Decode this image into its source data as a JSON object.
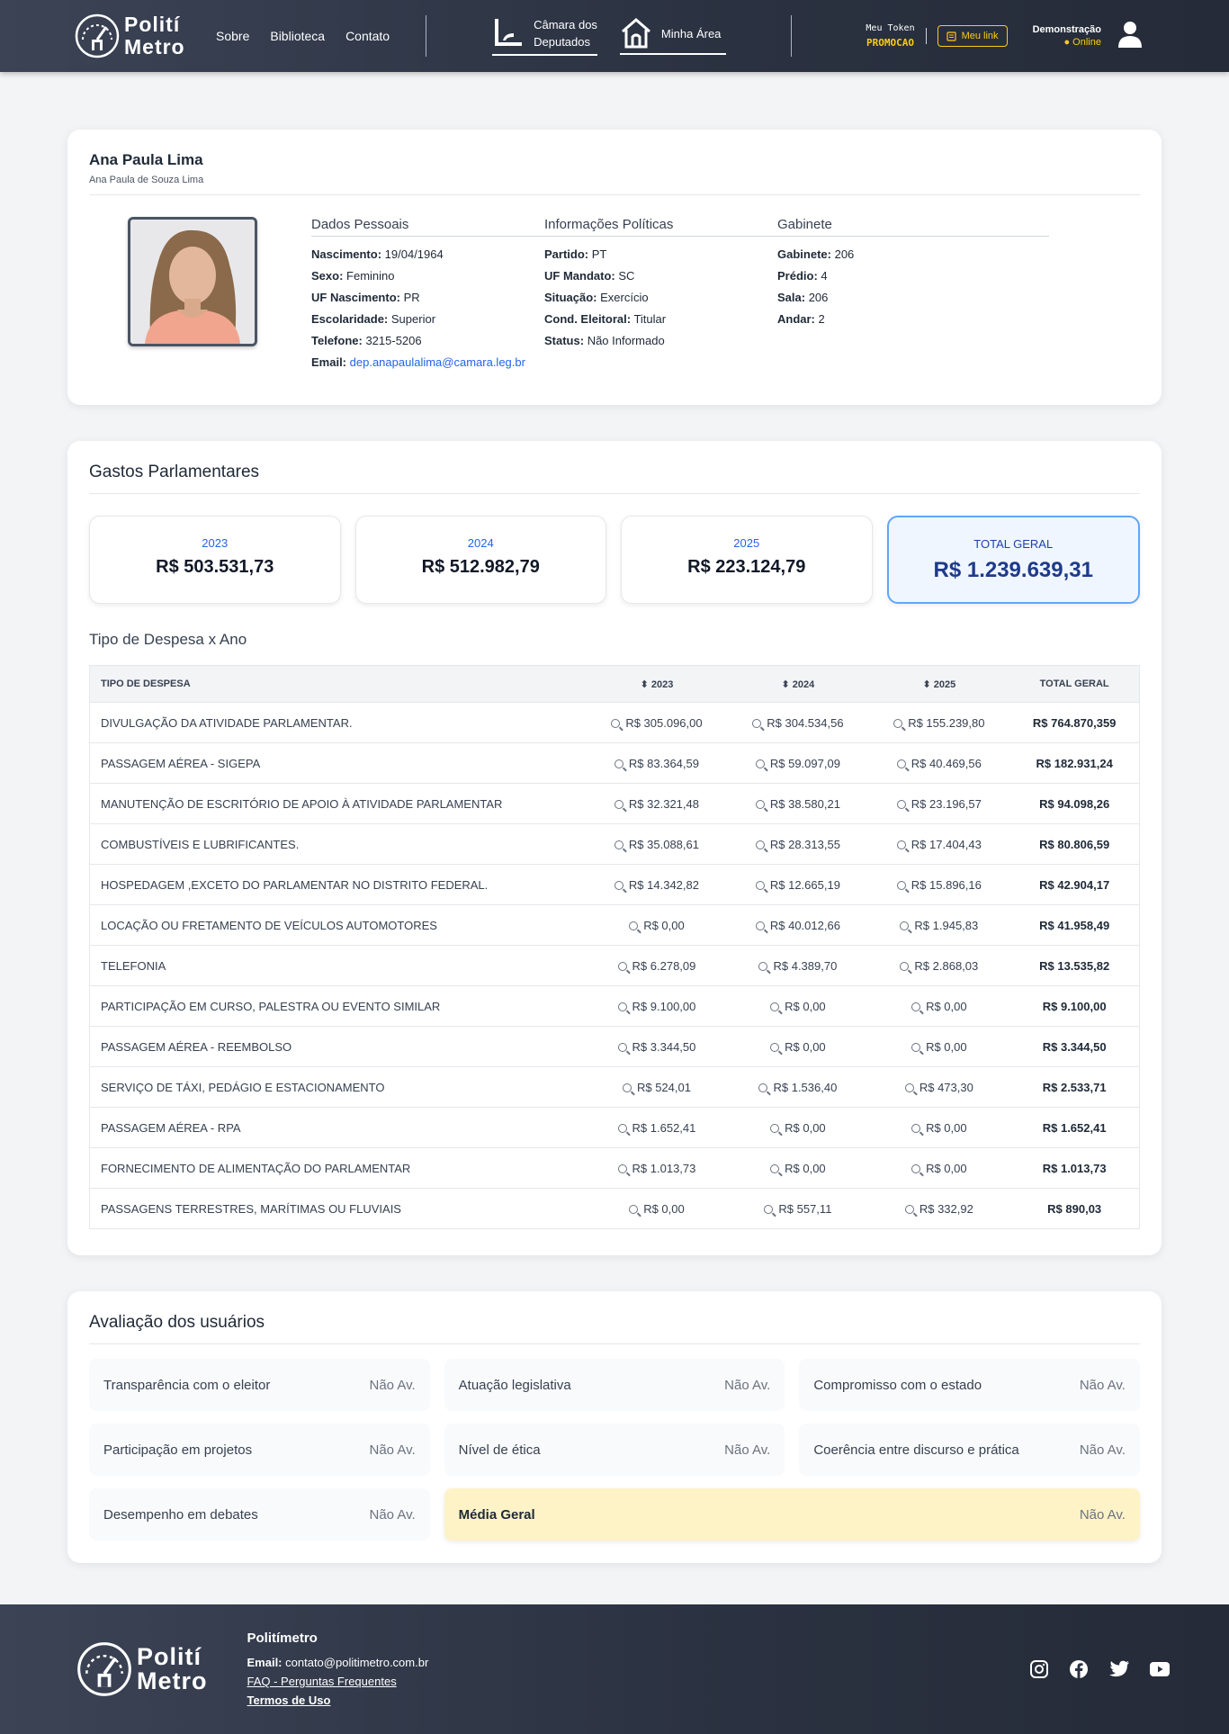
{
  "header": {
    "logo": {
      "line1": "Polití",
      "line2": "Metro"
    },
    "nav": [
      "Sobre",
      "Biblioteca",
      "Contato"
    ],
    "camara": {
      "line1": "Câmara dos",
      "line2": "Deputados"
    },
    "minha_area": "Minha Área",
    "token_label": "Meu Token",
    "token_value": "PROMOCAO",
    "meu_link": "Meu link",
    "user_name": "Demonstração",
    "user_status": "● Online"
  },
  "profile": {
    "name": "Ana Paula Lima",
    "full_name": "Ana Paula de Souza Lima",
    "dados_title": "Dados Pessoais",
    "dados": [
      {
        "label": "Nascimento:",
        "value": "19/04/1964"
      },
      {
        "label": "Sexo:",
        "value": "Feminino"
      },
      {
        "label": "UF Nascimento:",
        "value": "PR"
      },
      {
        "label": "Escolaridade:",
        "value": "Superior"
      },
      {
        "label": "Telefone:",
        "value": "3215-5206"
      },
      {
        "label": "Email:",
        "value": "dep.anapaulalima@camara.leg.br"
      }
    ],
    "politicas_title": "Informações Políticas",
    "politicas": [
      {
        "label": "Partido:",
        "value": "PT"
      },
      {
        "label": "UF Mandato:",
        "value": "SC"
      },
      {
        "label": "Situação:",
        "value": "Exercício"
      },
      {
        "label": "Cond. Eleitoral:",
        "value": "Titular"
      },
      {
        "label": "Status:",
        "value": "Não Informado"
      }
    ],
    "gabinete_title": "Gabinete",
    "gabinete": [
      {
        "label": "Gabinete:",
        "value": "206"
      },
      {
        "label": "Prédio:",
        "value": "4"
      },
      {
        "label": "Sala:",
        "value": "206"
      },
      {
        "label": "Andar:",
        "value": "2"
      }
    ]
  },
  "gastos": {
    "title": "Gastos Parlamentares",
    "years": [
      {
        "label": "2023",
        "value": "R$ 503.531,73"
      },
      {
        "label": "2024",
        "value": "R$ 512.982,79"
      },
      {
        "label": "2025",
        "value": "R$ 223.124,79"
      }
    ],
    "total": {
      "label": "TOTAL GERAL",
      "value": "R$ 1.239.639,31"
    },
    "table_title": "Tipo de Despesa x Ano",
    "columns": [
      "TIPO DE DESPESA",
      "⬍ 2023",
      "⬍ 2024",
      "⬍ 2025",
      "TOTAL GERAL"
    ],
    "rows": [
      [
        "DIVULGAÇÃO DA ATIVIDADE PARLAMENTAR.",
        "R$ 305.096,00",
        "R$ 304.534,56",
        "R$ 155.239,80",
        "R$ 764.870,359"
      ],
      [
        "PASSAGEM AÉREA - SIGEPA",
        "R$ 83.364,59",
        "R$ 59.097,09",
        "R$ 40.469,56",
        "R$ 182.931,24"
      ],
      [
        "MANUTENÇÃO DE ESCRITÓRIO DE APOIO À ATIVIDADE PARLAMENTAR",
        "R$ 32.321,48",
        "R$ 38.580,21",
        "R$ 23.196,57",
        "R$ 94.098,26"
      ],
      [
        "COMBUSTÍVEIS E LUBRIFICANTES.",
        "R$ 35.088,61",
        "R$ 28.313,55",
        "R$ 17.404,43",
        "R$ 80.806,59"
      ],
      [
        "HOSPEDAGEM ,EXCETO DO PARLAMENTAR NO DISTRITO FEDERAL.",
        "R$ 14.342,82",
        "R$ 12.665,19",
        "R$ 15.896,16",
        "R$ 42.904,17"
      ],
      [
        "LOCAÇÃO OU FRETAMENTO DE VEÍCULOS AUTOMOTORES",
        "R$ 0,00",
        "R$ 40.012,66",
        "R$ 1.945,83",
        "R$ 41.958,49"
      ],
      [
        "TELEFONIA",
        "R$ 6.278,09",
        "R$ 4.389,70",
        "R$ 2.868,03",
        "R$ 13.535,82"
      ],
      [
        "PARTICIPAÇÃO EM CURSO, PALESTRA OU EVENTO SIMILAR",
        "R$ 9.100,00",
        "R$ 0,00",
        "R$ 0,00",
        "R$ 9.100,00"
      ],
      [
        "PASSAGEM AÉREA - REEMBOLSO",
        "R$ 3.344,50",
        "R$ 0,00",
        "R$ 0,00",
        "R$ 3.344,50"
      ],
      [
        "SERVIÇO DE TÁXI, PEDÁGIO E ESTACIONAMENTO",
        "R$ 524,01",
        "R$ 1.536,40",
        "R$ 473,30",
        "R$ 2.533,71"
      ],
      [
        "PASSAGEM AÉREA - RPA",
        "R$ 1.652,41",
        "R$ 0,00",
        "R$ 0,00",
        "R$ 1.652,41"
      ],
      [
        "FORNECIMENTO DE ALIMENTAÇÃO DO PARLAMENTAR",
        "R$ 1.013,73",
        "R$ 0,00",
        "R$ 0,00",
        "R$ 1.013,73"
      ],
      [
        "PASSAGENS TERRESTRES, MARÍTIMAS OU FLUVIAIS",
        "R$ 0,00",
        "R$ 557,11",
        "R$ 332,92",
        "R$ 890,03"
      ]
    ]
  },
  "avaliacao": {
    "title": "Avaliação dos usuários",
    "items": [
      {
        "label": "Transparência com o eleitor",
        "value": "Não Av."
      },
      {
        "label": "Atuação legislativa",
        "value": "Não Av."
      },
      {
        "label": "Compromisso com o estado",
        "value": "Não Av."
      },
      {
        "label": "Participação em projetos",
        "value": "Não Av."
      },
      {
        "label": "Nível de ética",
        "value": "Não Av."
      },
      {
        "label": "Coerência entre discurso e prática",
        "value": "Não Av."
      },
      {
        "label": "Desempenho em debates",
        "value": "Não Av."
      }
    ],
    "media": {
      "label": "Média Geral",
      "value": "Não Av."
    }
  },
  "footer": {
    "logo": {
      "line1": "Polití",
      "line2": "Metro"
    },
    "title": "Politímetro",
    "email_label": "Email:",
    "email": "contato@politimetro.com.br",
    "faq_link": "FAQ - Perguntas Frequentes",
    "terms_link": "Termos de Uso",
    "social": [
      "instagram-icon",
      "facebook-icon",
      "twitter-icon",
      "youtube-icon"
    ]
  }
}
